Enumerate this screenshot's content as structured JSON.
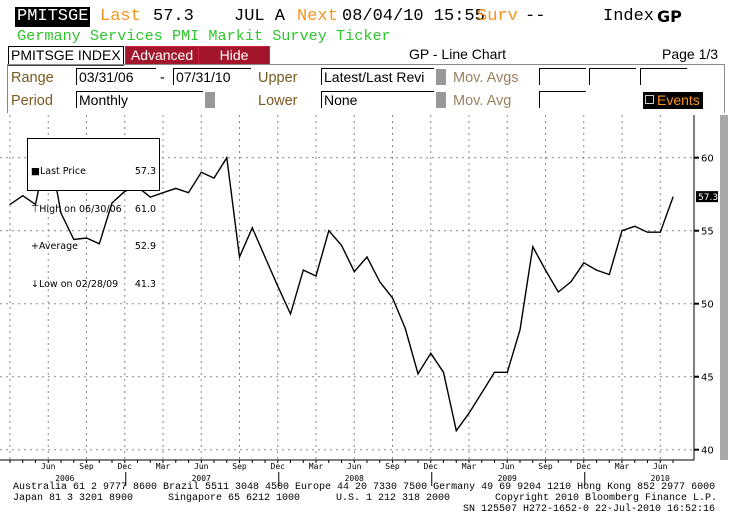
{
  "header": {
    "ticker": "PMITSGE",
    "last_label": "Last",
    "last_value": "57.3",
    "period": "JUL A",
    "next_label": "Next",
    "next_value": "08/04/10 15:55",
    "surv_label": "Surv",
    "surv_value": "--",
    "index_label": "Index",
    "index_code": "GP",
    "description": "Germany Services PMI Markit Survey Ticker"
  },
  "toolbar": {
    "security": "PMITSGE INDEX",
    "advanced_label": "Advanced",
    "hide_label": "Hide",
    "chart_title": "GP - Line Chart",
    "page": "Page 1/3"
  },
  "panel": {
    "range_label": "Range",
    "range_start": "03/31/06",
    "range_sep": "-",
    "range_end": "07/31/10",
    "upper_label": "Upper",
    "upper_value": "Latest/Last Revi",
    "mov_avgs_label": "Mov. Avgs",
    "period_label": "Period",
    "period_value": "Monthly",
    "lower_label": "Lower",
    "lower_value": "None",
    "mov_avg_label": "Mov. Avg",
    "events_label": "Events"
  },
  "legend": {
    "last_price_label": "Last Price",
    "last_price_value": "57.3",
    "high_label": "High on 06/30/06",
    "high_value": "61.0",
    "average_label": "Average",
    "average_value": "52.9",
    "low_label": "Low on 02/28/09",
    "low_value": "41.3"
  },
  "chart_data": {
    "type": "line",
    "x": [
      "2006-03",
      "2006-04",
      "2006-05",
      "2006-06",
      "2006-07",
      "2006-08",
      "2006-09",
      "2006-10",
      "2006-11",
      "2006-12",
      "2007-01",
      "2007-02",
      "2007-03",
      "2007-04",
      "2007-05",
      "2007-06",
      "2007-07",
      "2007-08",
      "2007-09",
      "2007-10",
      "2007-11",
      "2007-12",
      "2008-01",
      "2008-02",
      "2008-03",
      "2008-04",
      "2008-05",
      "2008-06",
      "2008-07",
      "2008-08",
      "2008-09",
      "2008-10",
      "2008-11",
      "2008-12",
      "2009-01",
      "2009-02",
      "2009-03",
      "2009-04",
      "2009-05",
      "2009-06",
      "2009-07",
      "2009-08",
      "2009-09",
      "2009-10",
      "2009-11",
      "2009-12",
      "2010-01",
      "2010-02",
      "2010-03",
      "2010-04",
      "2010-05",
      "2010-06",
      "2010-07"
    ],
    "series": [
      {
        "values": [
          56.8,
          57.4,
          56.8,
          61.0,
          56.2,
          54.4,
          54.5,
          54.1,
          56.9,
          57.7,
          58.0,
          57.3,
          57.6,
          57.9,
          57.6,
          59.0,
          58.6,
          60.0,
          53.2,
          55.2,
          53.2,
          51.2,
          49.3,
          52.3,
          51.9,
          55.0,
          54.0,
          52.2,
          53.2,
          51.5,
          50.4,
          48.3,
          45.2,
          46.6,
          45.3,
          41.3,
          42.5,
          43.9,
          45.3,
          45.3,
          48.2,
          53.9,
          52.3,
          50.8,
          51.5,
          52.8,
          52.3,
          52.0,
          55.0,
          55.3,
          54.9,
          54.9,
          57.3
        ]
      }
    ],
    "ylim": [
      40,
      62
    ],
    "y_ticks": [
      40,
      45,
      50,
      55,
      60
    ],
    "y_axis_side": "right",
    "x_tick_labels": [
      "Jun",
      "Sep",
      "Dec",
      "Mar",
      "Jun",
      "Sep",
      "Dec",
      "Mar",
      "Jun",
      "Sep",
      "Dec",
      "Mar",
      "Jun",
      "Sep",
      "Dec",
      "Mar",
      "Jun"
    ],
    "year_labels": [
      "2006",
      "2007",
      "2008",
      "2009",
      "2010"
    ],
    "last_value_tag": "57.3",
    "grid": true,
    "legend_placement": "top-left",
    "line_color": "#000000"
  },
  "footer": {
    "line1": "Australia 61 2 9777 8600 Brazil 5511 3048 4500 Europe 44 20 7330 7500 Germany 49 69 9204 1210 Hong Kong 852 2977 6000",
    "line2a": "Japan 81 3 3201 8900",
    "line2b": "Singapore 65 6212 1000",
    "line2c": "U.S. 1 212 318 2000",
    "line2d": "Copyright 2010 Bloomberg Finance L.P.",
    "line3": "SN 125507 H272-1652-0 22-Jul-2010 16:52:16"
  },
  "colors": {
    "accent_orange": "#f7941d",
    "title_green": "#2ec52e",
    "button_red": "#a3152b"
  }
}
